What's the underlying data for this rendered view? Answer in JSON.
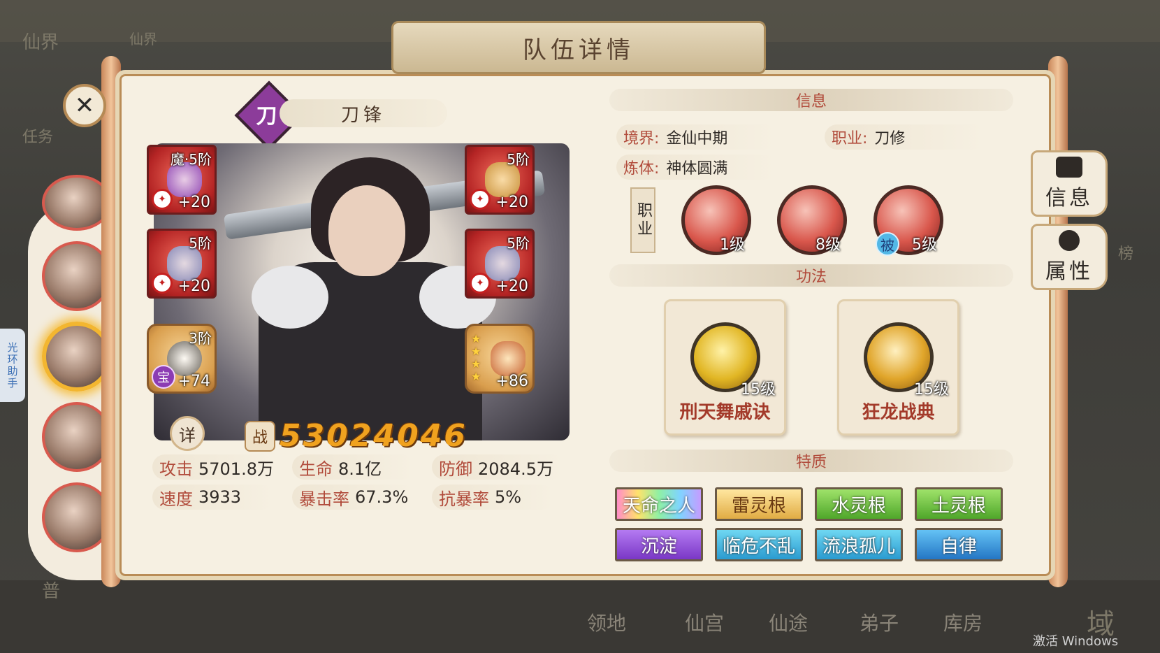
{
  "window_title": "队伍详情",
  "background": {
    "top_left_label": "仙界",
    "top_left_sub": "仙界",
    "left_menu": "任务",
    "side_helper": "光环助手",
    "right_label": "榜",
    "bottom_left": "普",
    "bottom_nav": [
      "领地",
      "仙宫",
      "仙途",
      "弟子",
      "库房"
    ],
    "bottom_right": "域"
  },
  "hero": {
    "class_glyph": "刀",
    "name": "刀锋",
    "power_label": "战",
    "power": "53024046",
    "detail_label": "详"
  },
  "equipment": [
    {
      "tier": "魔·5阶",
      "level": "+20"
    },
    {
      "tier": "5阶",
      "level": "+20"
    },
    {
      "tier": "5阶",
      "level": "+20"
    },
    {
      "tier": "5阶",
      "level": "+20"
    },
    {
      "tier": "3阶",
      "level": "+74",
      "badge": "宝"
    },
    {
      "tier": "",
      "level": "+86",
      "stars": 4
    }
  ],
  "stats": [
    {
      "label": "攻击",
      "value": "5701.8万"
    },
    {
      "label": "生命",
      "value": "8.1亿"
    },
    {
      "label": "防御",
      "value": "2084.5万"
    },
    {
      "label": "速度",
      "value": "3933"
    },
    {
      "label": "暴击率",
      "value": "67.3%"
    },
    {
      "label": "抗暴率",
      "value": "5%"
    }
  ],
  "info": {
    "header": "信息",
    "realm_label": "境界:",
    "realm": "金仙中期",
    "job_label": "职业:",
    "job": "刀修",
    "body_label": "炼体:",
    "body": "神体圆满",
    "job_tag": "职业",
    "skills": [
      {
        "level": "1级"
      },
      {
        "level": "8级"
      },
      {
        "level": "5级",
        "passive": "被"
      }
    ]
  },
  "gongfa": {
    "header": "功法",
    "items": [
      {
        "name": "刑天舞戚诀",
        "level": "15级"
      },
      {
        "name": "狂龙战典",
        "level": "15级"
      }
    ]
  },
  "traits": {
    "header": "特质",
    "items": [
      "天命之人",
      "雷灵根",
      "水灵根",
      "土灵根",
      "沉淀",
      "临危不乱",
      "流浪孤儿",
      "自律"
    ]
  },
  "right_tabs": [
    "信息",
    "属性"
  ],
  "watermark": "激活 Windows",
  "colors": {
    "accent_red": "#b14b3b",
    "power_gold": "#f0a21f",
    "panel_bg": "#f6f0e2"
  }
}
